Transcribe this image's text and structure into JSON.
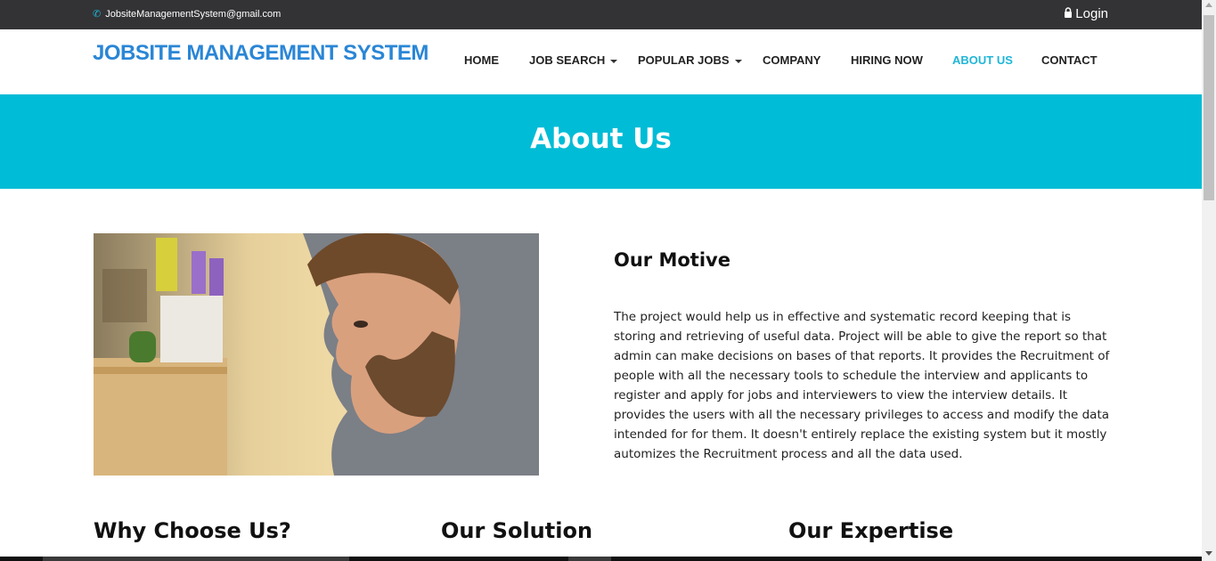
{
  "topbar": {
    "email": "JobsiteManagementSystem@gmail.com",
    "email_icon": "phone-icon",
    "login_label": "Login",
    "login_icon": "lock-icon"
  },
  "navbar": {
    "brand": "JOBSITE MANAGEMENT SYSTEM",
    "items": [
      {
        "label": "HOME",
        "dropdown": false,
        "active": false
      },
      {
        "label": "JOB SEARCH",
        "dropdown": true,
        "active": false
      },
      {
        "label": "POPULAR JOBS",
        "dropdown": true,
        "active": false
      },
      {
        "label": "COMPANY",
        "dropdown": false,
        "active": false
      },
      {
        "label": "HIRING NOW",
        "dropdown": false,
        "active": false
      },
      {
        "label": "ABOUT US",
        "dropdown": false,
        "active": true
      },
      {
        "label": "CONTACT",
        "dropdown": false,
        "active": false
      }
    ]
  },
  "banner": {
    "title": "About Us"
  },
  "motive": {
    "title": "Our Motive",
    "text": "The project would help us in effective and systematic record keeping that is storing and retrieving of useful data. Project will be able to give the report so that admin can make decisions on bases of that reports. It provides the Recruitment of people with all the necessary tools to schedule the interview and applicants to register and apply for jobs and interviewers to view the interview details. It provides the users with all the necessary privileges to access and modify the data intended for for them. It doesn't entirely replace the existing system but it mostly automizes the Recruitment process and all the data used."
  },
  "sections": [
    {
      "title": "Why Choose Us?"
    },
    {
      "title": "Our Solution"
    },
    {
      "title": "Our Expertise"
    }
  ],
  "colors": {
    "topbar_bg": "#333336",
    "accent": "#01bcd6",
    "brand": "#2a86d6"
  }
}
